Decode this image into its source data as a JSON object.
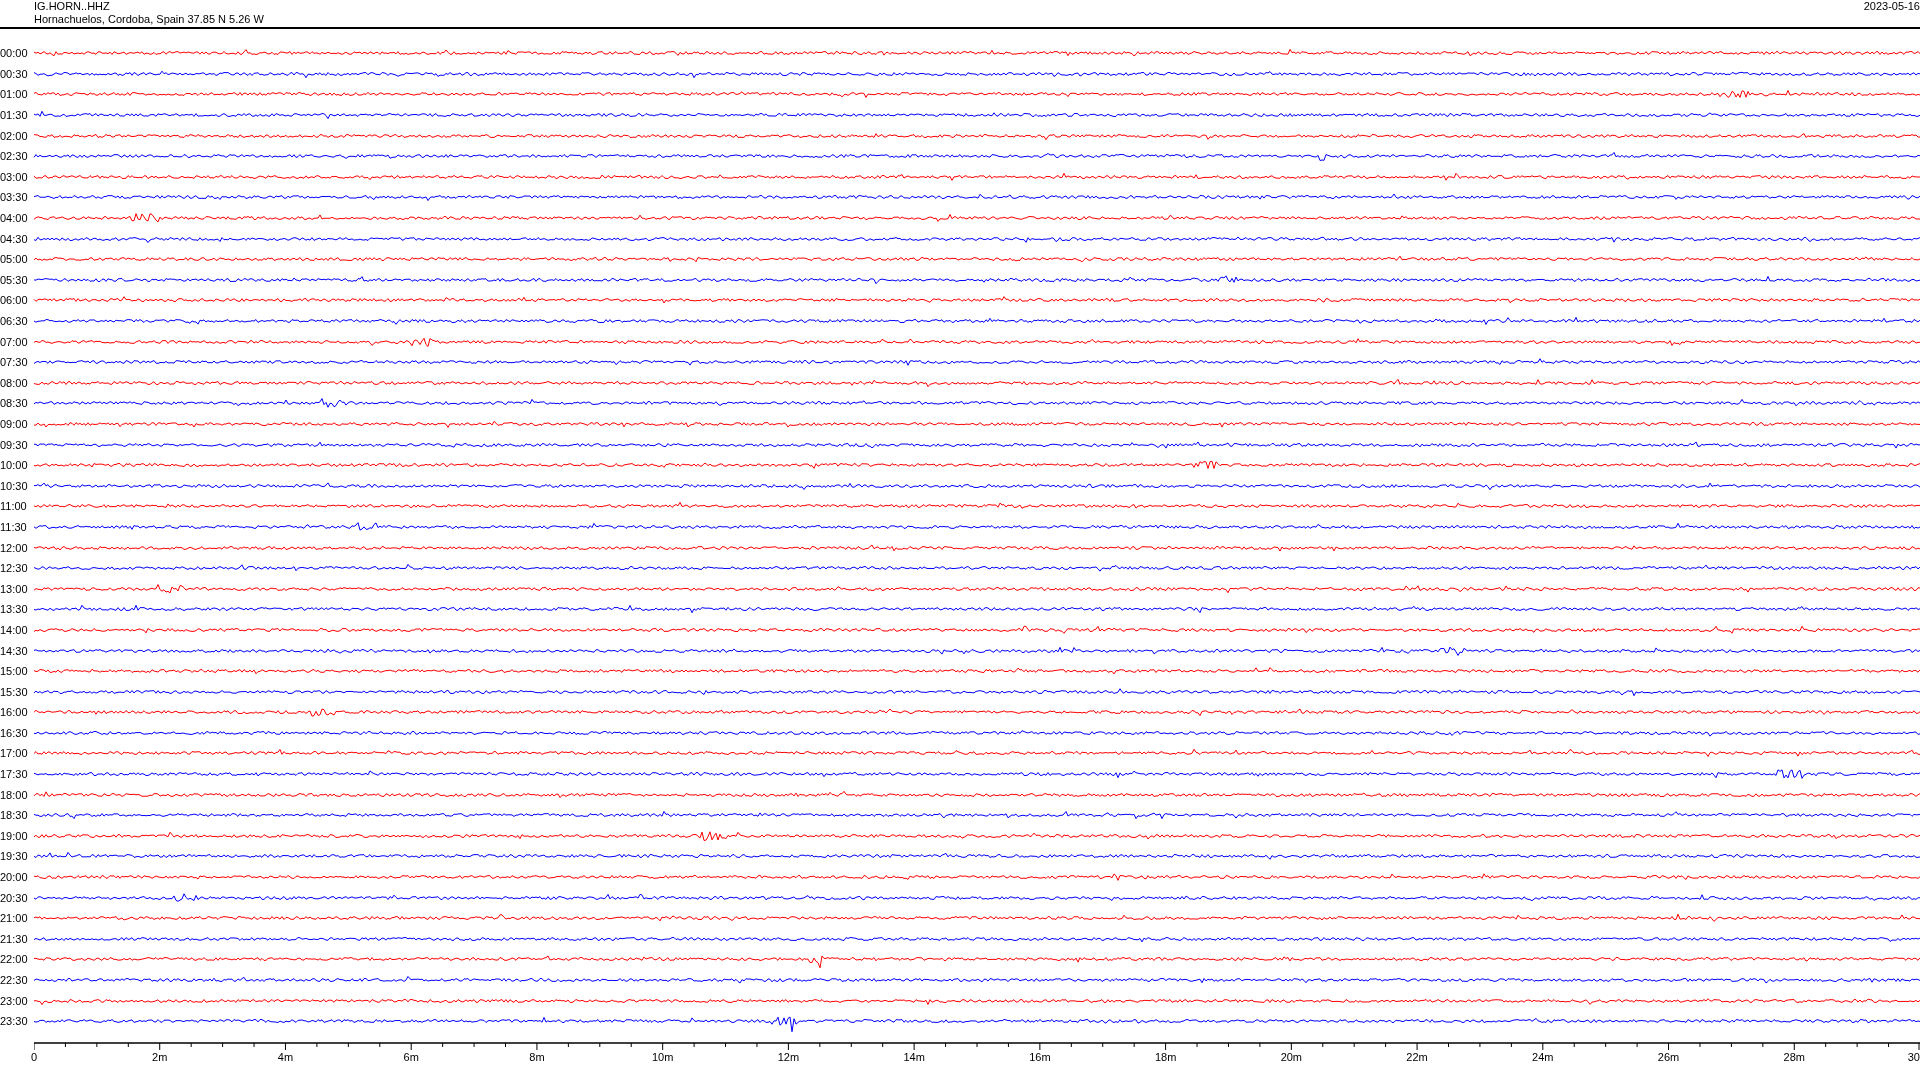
{
  "header": {
    "station": "IG.HORN..HHZ",
    "location": "Hornachuelos, Cordoba, Spain  37.85 N 5.26 W",
    "date": "2023-05-16"
  },
  "rows": [
    {
      "label": "00:00",
      "color": "#ff0000"
    },
    {
      "label": "00:30",
      "color": "#0000ff"
    },
    {
      "label": "01:00",
      "color": "#ff0000"
    },
    {
      "label": "01:30",
      "color": "#0000ff"
    },
    {
      "label": "02:00",
      "color": "#ff0000"
    },
    {
      "label": "02:30",
      "color": "#0000ff"
    },
    {
      "label": "03:00",
      "color": "#ff0000"
    },
    {
      "label": "03:30",
      "color": "#0000ff"
    },
    {
      "label": "04:00",
      "color": "#ff0000"
    },
    {
      "label": "04:30",
      "color": "#0000ff"
    },
    {
      "label": "05:00",
      "color": "#ff0000"
    },
    {
      "label": "05:30",
      "color": "#0000ff"
    },
    {
      "label": "06:00",
      "color": "#ff0000"
    },
    {
      "label": "06:30",
      "color": "#0000ff"
    },
    {
      "label": "07:00",
      "color": "#ff0000"
    },
    {
      "label": "07:30",
      "color": "#0000ff"
    },
    {
      "label": "08:00",
      "color": "#ff0000"
    },
    {
      "label": "08:30",
      "color": "#0000ff"
    },
    {
      "label": "09:00",
      "color": "#ff0000"
    },
    {
      "label": "09:30",
      "color": "#0000ff"
    },
    {
      "label": "10:00",
      "color": "#ff0000"
    },
    {
      "label": "10:30",
      "color": "#0000ff"
    },
    {
      "label": "11:00",
      "color": "#ff0000"
    },
    {
      "label": "11:30",
      "color": "#0000ff"
    },
    {
      "label": "12:00",
      "color": "#ff0000"
    },
    {
      "label": "12:30",
      "color": "#0000ff"
    },
    {
      "label": "13:00",
      "color": "#ff0000"
    },
    {
      "label": "13:30",
      "color": "#0000ff"
    },
    {
      "label": "14:00",
      "color": "#ff0000"
    },
    {
      "label": "14:30",
      "color": "#0000ff"
    },
    {
      "label": "15:00",
      "color": "#ff0000"
    },
    {
      "label": "15:30",
      "color": "#0000ff"
    },
    {
      "label": "16:00",
      "color": "#ff0000"
    },
    {
      "label": "16:30",
      "color": "#0000ff"
    },
    {
      "label": "17:00",
      "color": "#ff0000"
    },
    {
      "label": "17:30",
      "color": "#0000ff"
    },
    {
      "label": "18:00",
      "color": "#ff0000"
    },
    {
      "label": "18:30",
      "color": "#0000ff"
    },
    {
      "label": "19:00",
      "color": "#ff0000"
    },
    {
      "label": "19:30",
      "color": "#0000ff"
    },
    {
      "label": "20:00",
      "color": "#ff0000"
    },
    {
      "label": "20:30",
      "color": "#0000ff"
    },
    {
      "label": "21:00",
      "color": "#ff0000"
    },
    {
      "label": "21:30",
      "color": "#0000ff"
    },
    {
      "label": "22:00",
      "color": "#ff0000"
    },
    {
      "label": "22:30",
      "color": "#0000ff"
    },
    {
      "label": "23:00",
      "color": "#ff0000"
    },
    {
      "label": "23:30",
      "color": "#0000ff"
    }
  ],
  "axis": {
    "labels": [
      "0",
      "2m",
      "4m",
      "6m",
      "8m",
      "10m",
      "12m",
      "14m",
      "16m",
      "18m",
      "20m",
      "22m",
      "24m",
      "26m",
      "28m",
      "30"
    ]
  }
}
